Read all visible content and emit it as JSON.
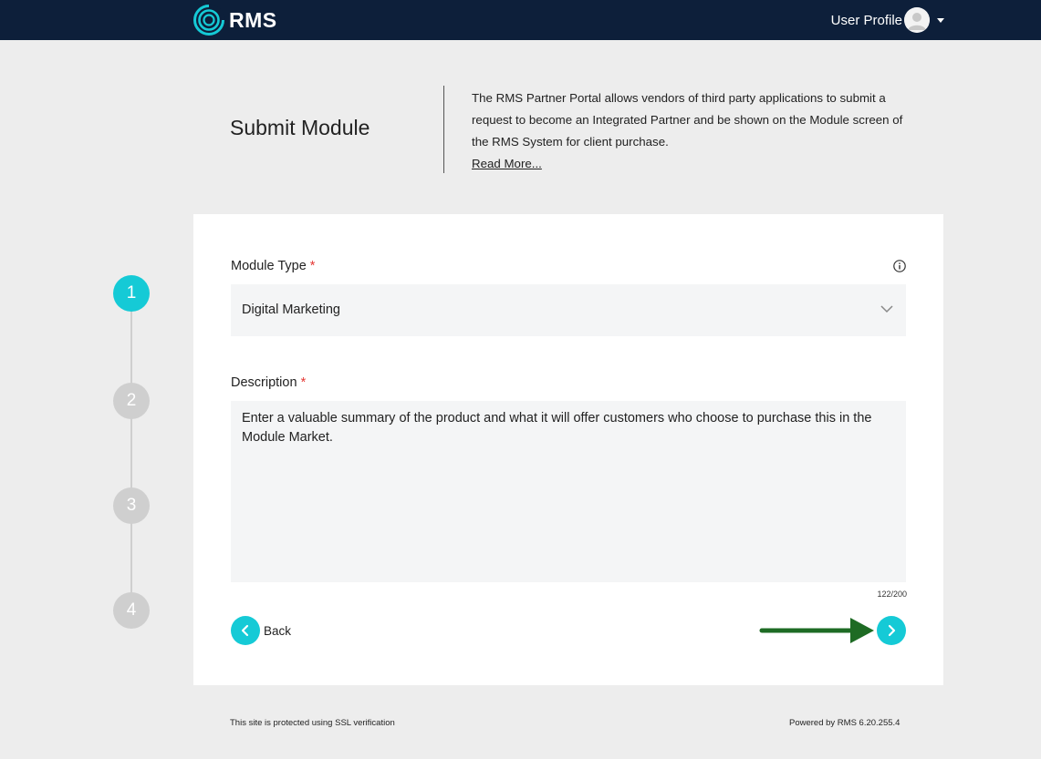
{
  "header": {
    "logo_text": "RMS",
    "user_profile_label": "User Profile"
  },
  "page": {
    "title": "Submit Module",
    "intro_text": "The RMS Partner Portal allows vendors of third party applications to submit a request to become an Integrated Partner and be shown on the Module screen of the RMS System for client purchase.",
    "read_more_label": "Read More..."
  },
  "stepper": {
    "steps": [
      "1",
      "2",
      "3",
      "4"
    ],
    "active_step": 1
  },
  "form": {
    "module_type_label": "Module Type",
    "required_mark": "*",
    "module_type_value": "Digital Marketing",
    "description_label": "Description",
    "description_value": "Enter a valuable summary of the product and what it will offer customers who choose to purchase this in the Module Market.",
    "char_counter": "122/200",
    "back_label": "Back"
  },
  "footer": {
    "ssl_text": "This site is protected using SSL verification",
    "powered_by": "Powered by RMS 6.20.255.4"
  },
  "colors": {
    "topbar": "#0d1f3a",
    "accent": "#15cad6",
    "step_inactive": "#cfcfcf",
    "required": "#e53935",
    "annotation_arrow": "#1e6b24"
  },
  "icons": [
    "rms-logo-icon",
    "avatar-icon",
    "caret-down-icon",
    "info-icon",
    "chevron-down-icon",
    "chevron-left-icon",
    "chevron-right-icon",
    "arrow-right-annotation-icon"
  ]
}
